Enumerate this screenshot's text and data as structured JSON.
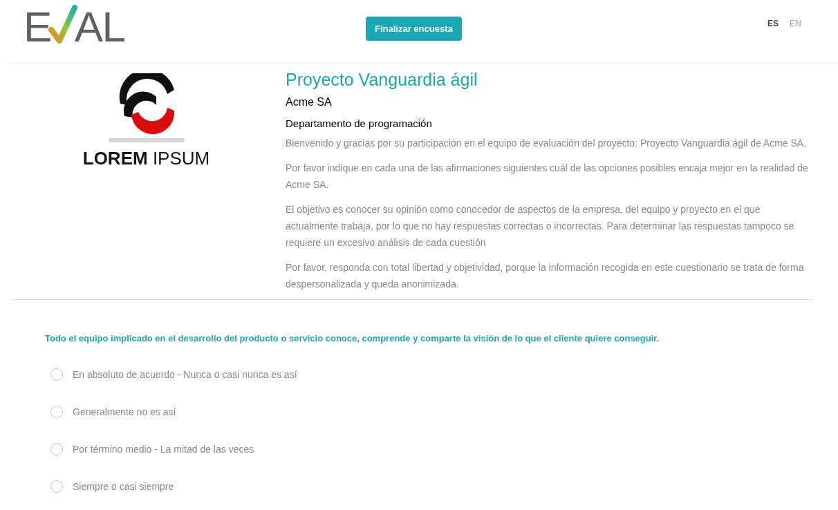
{
  "header": {
    "logo": {
      "before": "E",
      "after": "AL"
    },
    "finish_button": "Finalizar encuesta",
    "languages": [
      {
        "label": "ES",
        "selected": true
      },
      {
        "label": "EN",
        "selected": false
      }
    ]
  },
  "project": {
    "company_logo": "**LOREM** IPSUM",
    "title": "Proyecto Vanguardia ágil",
    "company": "Acme SA",
    "department": "Departamento de programación",
    "paragraphs": [
      "Bienvenido y gracias por su participación en el equipo de evaluación del proyecto: Proyecto Vanguardia ágil de Acme SA.",
      "Por favor indique en cada una de las afirmaciones siguientes cuál de las opciones posibles encaja mejor en la realidad de Acme SA.",
      "El objetivo es conocer su opinión como conocedor de aspectos de la empresa, del equipo y proyecto en el que actualmente trabaja, por lo que no hay respuestas correctas o incorrectas. Para determinar las respuestas tampoco se requiere un excesivo análisis de cada cuestión",
      "Por favor, responda con total libertad y objetividad, porque la información recogida en este cuestionario se trata de forma despersonalizada y queda anonimizada."
    ]
  },
  "question": {
    "text": "Todo el equipo implicado en el desarrollo del producto o servicio conoce, comprende y comparte la visión de lo que el cliente quiere conseguir.",
    "options": [
      {
        "label": "En absoluto de acuerdo - Nunca o casi nunca es así",
        "selected": false
      },
      {
        "label": "Generalmente no es así",
        "selected": false
      },
      {
        "label": "Por término medio - La mitad de las veces",
        "selected": false
      },
      {
        "label": "Siempre o casi siempre",
        "selected": false
      }
    ]
  }
}
